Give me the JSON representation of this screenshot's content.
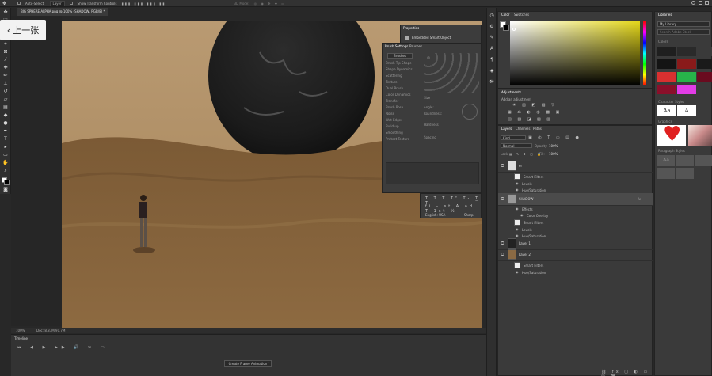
{
  "options_bar": {
    "auto_select": "Auto-Select:",
    "auto_select_value": "Layer",
    "transform_controls": "Show Transform Controls",
    "mode_3d": "3D Mode:"
  },
  "document": {
    "tab_title": "BIG SPHERE ALPHA.png @ 100% (SHADOW, RGB/8) *",
    "zoom": "100%",
    "doc_info": "Doc: 8.87M/91.7M"
  },
  "overlay": {
    "prev_label": "上一张"
  },
  "properties_panel": {
    "title": "Properties",
    "subtitle": "Embedded Smart Object"
  },
  "brush_panel": {
    "tabs": [
      "Brush Settings",
      "Brushes"
    ],
    "brushes_btn": "Brushes",
    "options": [
      "Brush Tip Shape",
      "Shape Dynamics",
      "Scattering",
      "Texture",
      "Dual Brush",
      "Color Dynamics",
      "Transfer",
      "Brush Pose",
      "Noise",
      "Wet Edges",
      "Build-up",
      "Smoothing",
      "Protect Texture"
    ],
    "size_label": "Size",
    "angle_label": "Angle:",
    "roundness_label": "Roundness:",
    "hardness_label": "Hardness",
    "spacing_label": "Spacing"
  },
  "character_panel": {
    "language": "English: USA",
    "aa": "Sharp"
  },
  "color_panel": {
    "tabs": [
      "Color",
      "Swatches"
    ],
    "fg_color": "#ffffff",
    "bg_color": "#000000",
    "hue": "#e3d61a"
  },
  "adjustments_panel": {
    "title": "Adjustments",
    "hint": "Add an adjustment"
  },
  "layers_panel": {
    "tabs": [
      "Layers",
      "Channels",
      "Paths"
    ],
    "filter_kind": "Kind",
    "blend_mode": "Normal",
    "opacity_label": "Opacity:",
    "opacity_value": "100%",
    "lock_label": "Lock:",
    "fill_label": "Fill:",
    "fill_value": "100%",
    "layers": [
      {
        "name": "er",
        "subs": [
          "Smart Filters",
          "Levels",
          "Hue/Saturation"
        ]
      },
      {
        "name": "SHADOW",
        "subs": [
          "Effects",
          "Color Overlay",
          "Smart Filters",
          "Levels",
          "Hue/Saturation"
        ]
      },
      {
        "name": "Layer 1",
        "subs": []
      },
      {
        "name": "Layer 2",
        "subs": [
          "Smart Filters",
          "Hue/Saturation"
        ]
      }
    ]
  },
  "libraries_panel": {
    "title": "Libraries",
    "library_name": "My Library",
    "search_placeholder": "Search Adobe Stock",
    "colors_label": "Colors",
    "char_styles_label": "Character Styles",
    "char_style_1": "Aa",
    "char_style_2": "A",
    "graphics_label": "Graphics",
    "para_styles_label": "Paragraph Styles",
    "para_style": "Aa",
    "colors": [
      "#1f1f1f",
      "#2a2a2a",
      "#3a3a3a",
      "#141414",
      "#8a1a1a",
      "#1a1a1a",
      "#d93030",
      "#27b34a",
      "#6a0b1f",
      "#8a0f2a",
      "#e23ce6"
    ]
  },
  "timeline": {
    "title": "Timeline",
    "create_label": "Create Frame Animation"
  }
}
